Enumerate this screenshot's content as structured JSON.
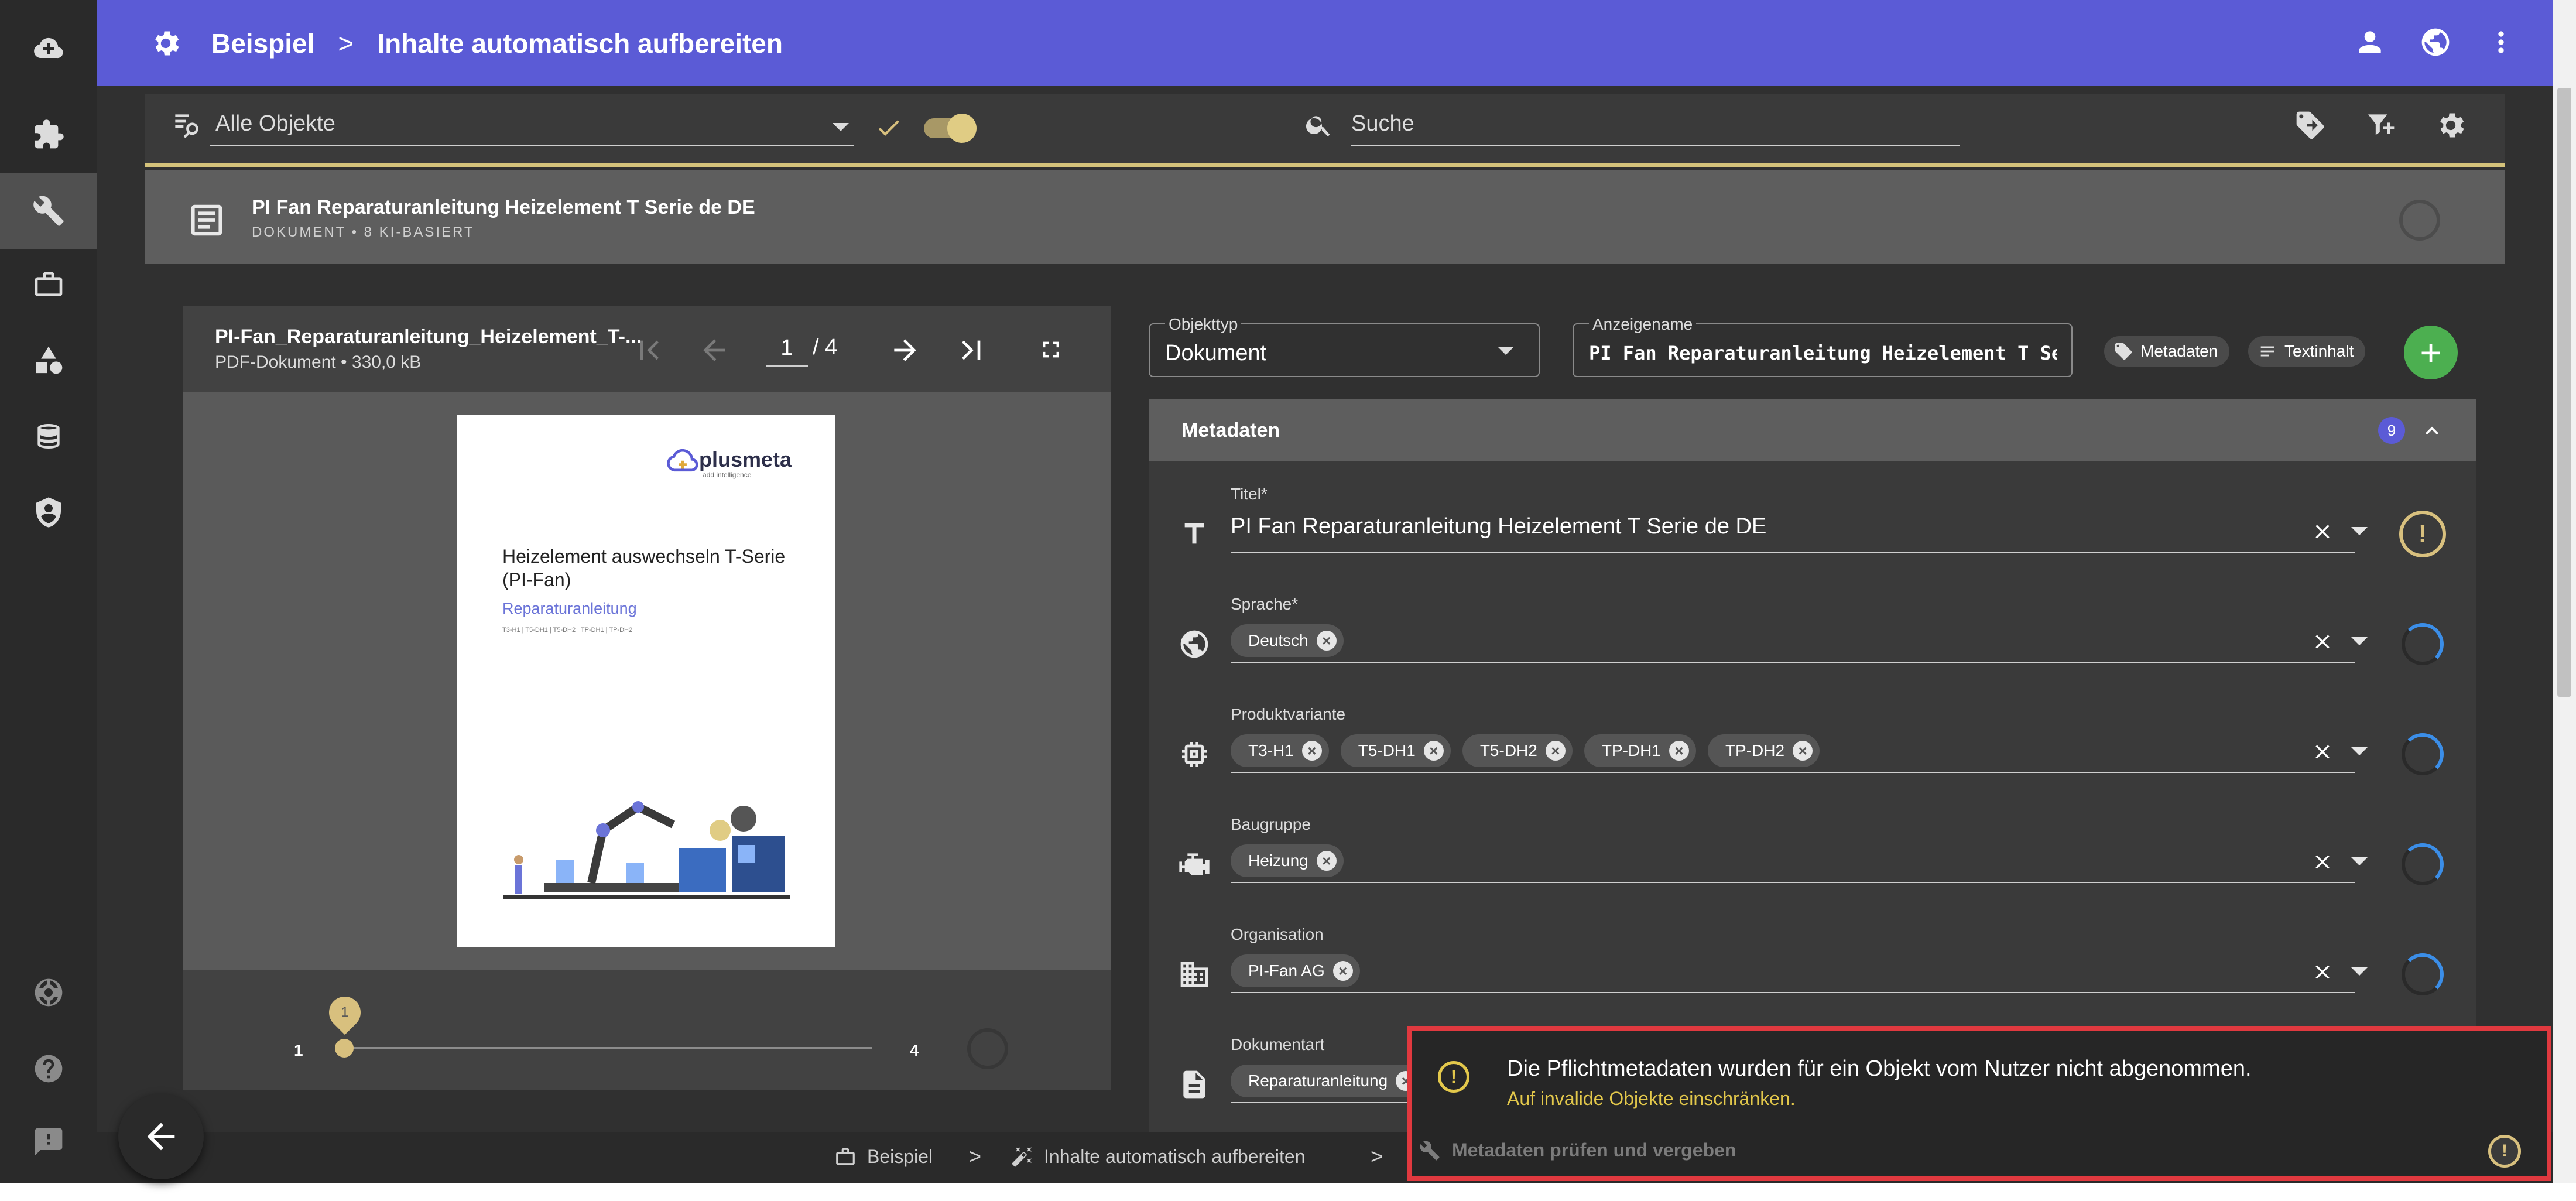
{
  "topbar": {
    "crumb1": "Beispiel",
    "separator": ">",
    "crumb2": "Inhalte automatisch aufbereiten"
  },
  "filter": {
    "select_value": "Alle Objekte",
    "search_placeholder": "Suche"
  },
  "document": {
    "title": "PI Fan Reparaturanleitung Heizelement T Serie de DE",
    "subtitle": "DOKUMENT • 8 KI-BASIERT"
  },
  "viewer": {
    "filename": "PI-Fan_Reparaturanleitung_Heizelement_T-...",
    "meta": "PDF-Dokument • 330,0 kB",
    "current_page": "1",
    "total_pages": "/ 4",
    "slider_min": "1",
    "slider_max": "4",
    "slider_value": "1",
    "paper": {
      "logo": "plusmeta",
      "logo_sub": "add intelligence",
      "title": "Heizelement auswechseln T-Serie (PI-Fan)",
      "subtitle": "Reparaturanleitung",
      "variants": "T3-H1 | T5-DH1 | T5-DH2 | TP-DH1 | TP-DH2"
    }
  },
  "object_type": {
    "label": "Objekttyp",
    "value": "Dokument"
  },
  "display_name": {
    "label": "Anzeigename",
    "value": "PI Fan Reparaturanleitung Heizelement T Serie de DE"
  },
  "chips": {
    "metadata": "Metadaten",
    "textcontent": "Textinhalt"
  },
  "metadata": {
    "header": "Metadaten",
    "count": "9",
    "fields": [
      {
        "label": "Titel*",
        "value": "PI Fan Reparaturanleitung Heizelement T Serie de DE"
      },
      {
        "label": "Sprache*",
        "chips": [
          "Deutsch"
        ]
      },
      {
        "label": "Produktvariante",
        "chips": [
          "T3-H1",
          "T5-DH1",
          "T5-DH2",
          "TP-DH1",
          "TP-DH2"
        ]
      },
      {
        "label": "Baugruppe",
        "chips": [
          "Heizung"
        ]
      },
      {
        "label": "Organisation",
        "chips": [
          "PI-Fan AG"
        ]
      },
      {
        "label": "Dokumentart",
        "chips": [
          "Reparaturanleitung"
        ]
      }
    ]
  },
  "bottombar": {
    "item1": "Beispiel",
    "item2": "Inhalte automatisch aufbereiten",
    "item3": "Metadaten prüfen und vergeben"
  },
  "toast": {
    "message": "Die Pflichtmetadaten wurden für ein Objekt vom Nutzer nicht abgenommen.",
    "link": "Auf invalide Objekte einschränken."
  },
  "colors": {
    "topbar": "#5b5bd6",
    "accent_gold": "#d8c07e",
    "toast_border": "#e0393f",
    "fab_green": "#4caf50"
  }
}
